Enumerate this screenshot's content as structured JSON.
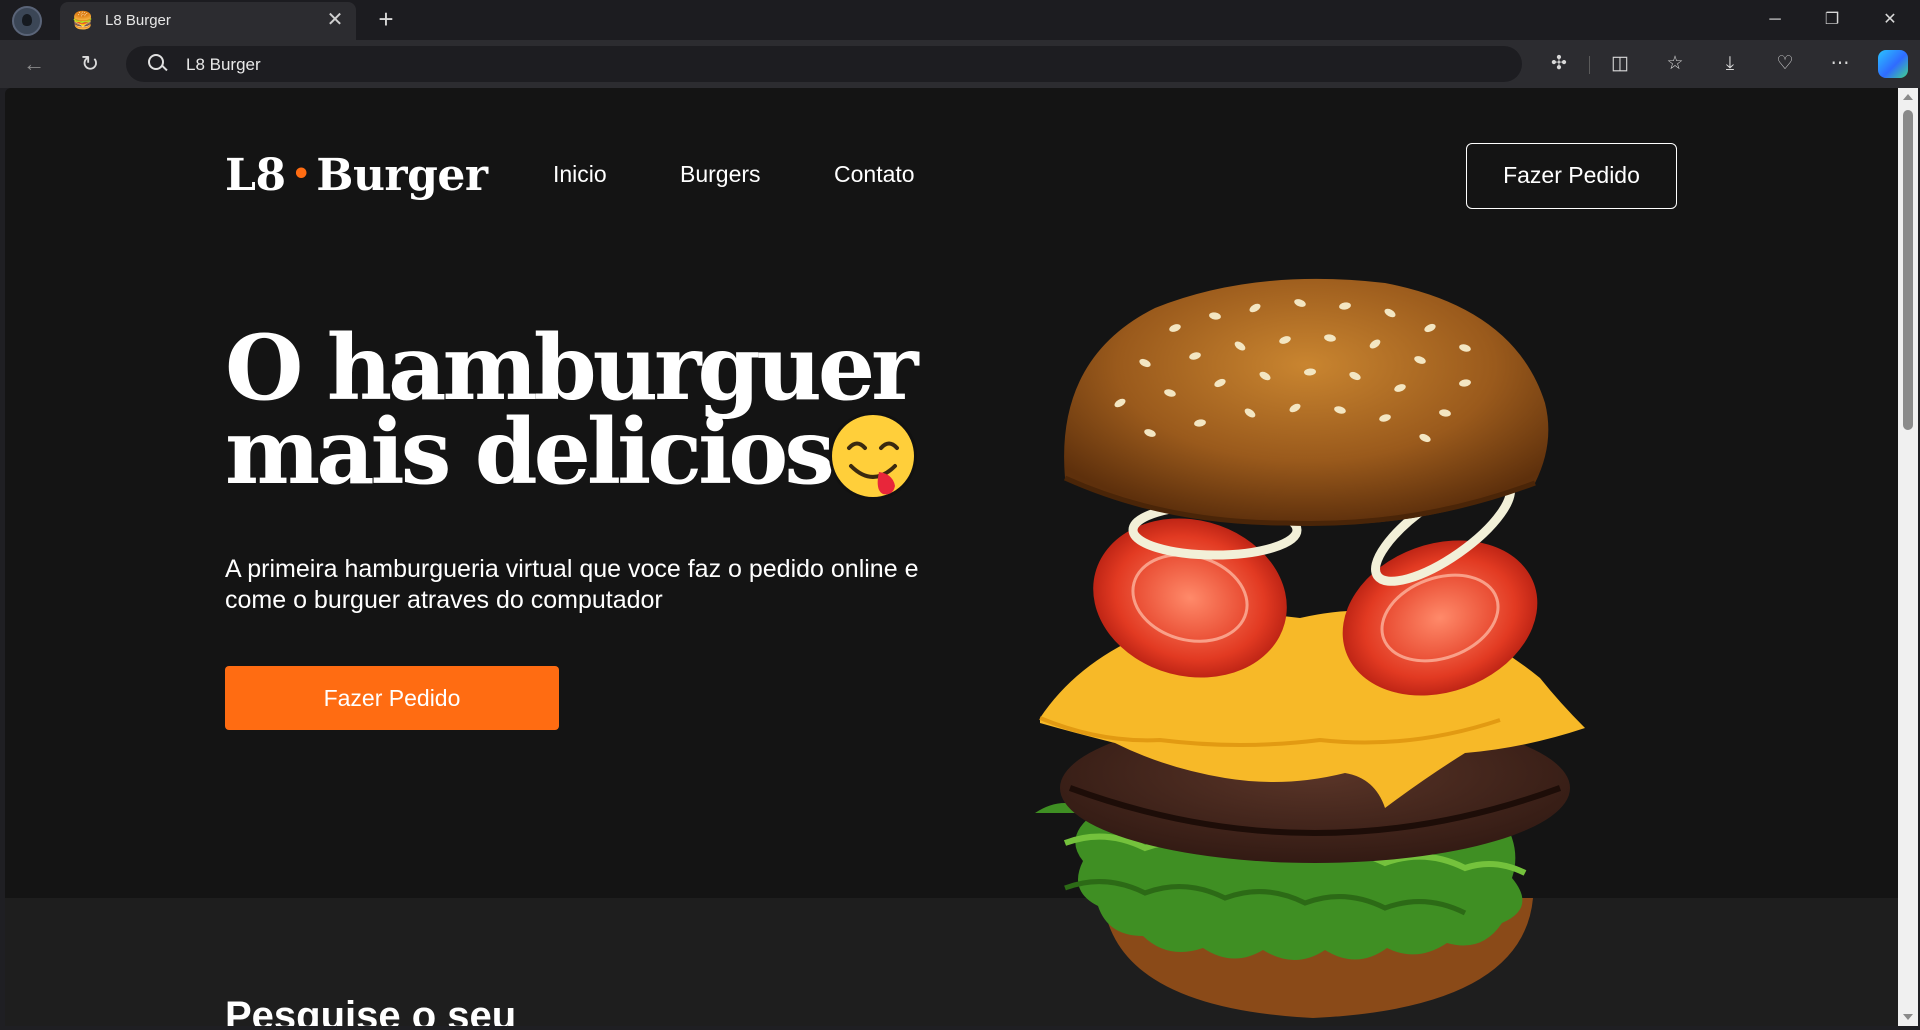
{
  "browser": {
    "tab_title": "L8 Burger",
    "tab_favicon": "🍔",
    "tab_close": "✕",
    "new_tab": "+",
    "address_text": "L8 Burger",
    "window_controls": {
      "minimize": "─",
      "restore": "❐",
      "close": "✕"
    },
    "icons": [
      "back-arrow-icon",
      "refresh-icon",
      "search-icon",
      "extensions-icon",
      "split-screen-icon",
      "favorites-icon",
      "downloads-icon",
      "browser-essentials-icon",
      "more-icon",
      "copilot-icon"
    ]
  },
  "site": {
    "logo": {
      "left": "L8",
      "dot": "•",
      "right": "Burger"
    },
    "nav": [
      "Inicio",
      "Burgers",
      "Contato"
    ],
    "header_cta": "Fazer Pedido",
    "hero": {
      "title_line1": "O hamburguer",
      "title_line2": "mais delicioso.",
      "emoji": "yum-face-emoji",
      "description": "A primeira hamburgueria virtual que voce faz o pedido online e come o burguer atraves do computador",
      "cta": "Fazer Pedido"
    },
    "section2_heading": "Pesquise o seu",
    "colors": {
      "background": "#141414",
      "accent": "#ff6c12",
      "text": "#ffffff"
    }
  }
}
